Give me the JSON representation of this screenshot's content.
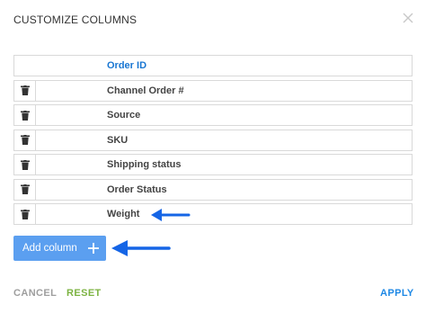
{
  "dialog": {
    "title": "CUSTOMIZE COLUMNS"
  },
  "columns": [
    {
      "label": "Order ID",
      "deletable": false
    },
    {
      "label": "Channel Order #",
      "deletable": true
    },
    {
      "label": "Source",
      "deletable": true
    },
    {
      "label": "SKU",
      "deletable": true
    },
    {
      "label": "Shipping status",
      "deletable": true
    },
    {
      "label": "Order Status",
      "deletable": true
    },
    {
      "label": "Weight",
      "deletable": true
    }
  ],
  "actions": {
    "add_column_label": "Add column",
    "cancel_label": "CANCEL",
    "reset_label": "RESET",
    "apply_label": "APPLY"
  },
  "icons": {
    "close": "close-icon",
    "delete": "trash-icon",
    "add": "plus-icon",
    "annotation": "arrow-left-icon"
  },
  "colors": {
    "accent_blue": "#1976d2",
    "add_button": "#5b9ff0",
    "reset_green": "#7cb342",
    "annotation_arrow": "#1565e6"
  }
}
